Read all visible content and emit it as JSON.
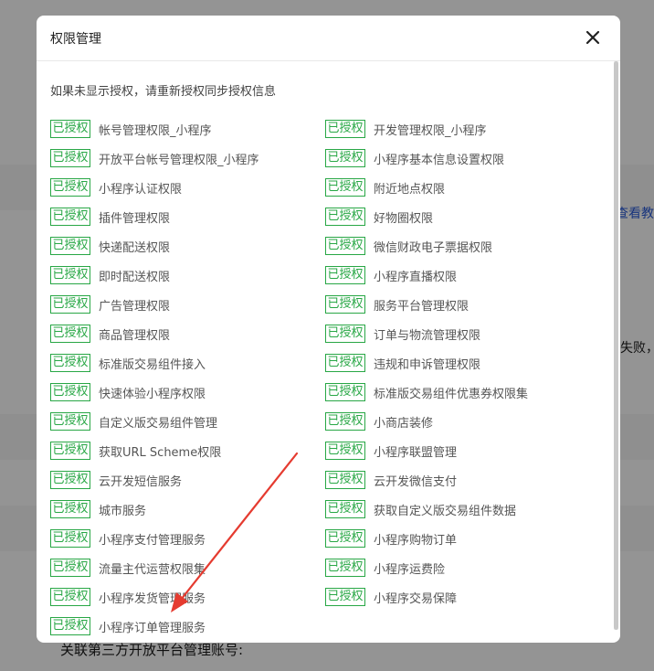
{
  "background": {
    "link_fragment": "查看教程",
    "text_fragment": "失败，请",
    "bottom_text": "关联第三方开放平台管理账号:"
  },
  "modal": {
    "title": "权限管理",
    "hint": "如果未显示授权，请重新授权同步授权信息",
    "badge_label": "已授权",
    "permissions": [
      {
        "name": "帐号管理权限_小程序",
        "status": "已授权"
      },
      {
        "name": "开发管理权限_小程序",
        "status": "已授权"
      },
      {
        "name": "开放平台帐号管理权限_小程序",
        "status": "已授权"
      },
      {
        "name": "小程序基本信息设置权限",
        "status": "已授权"
      },
      {
        "name": "小程序认证权限",
        "status": "已授权"
      },
      {
        "name": "附近地点权限",
        "status": "已授权"
      },
      {
        "name": "插件管理权限",
        "status": "已授权"
      },
      {
        "name": "好物圈权限",
        "status": "已授权"
      },
      {
        "name": "快递配送权限",
        "status": "已授权"
      },
      {
        "name": "微信财政电子票据权限",
        "status": "已授权"
      },
      {
        "name": "即时配送权限",
        "status": "已授权"
      },
      {
        "name": "小程序直播权限",
        "status": "已授权"
      },
      {
        "name": "广告管理权限",
        "status": "已授权"
      },
      {
        "name": "服务平台管理权限",
        "status": "已授权"
      },
      {
        "name": "商品管理权限",
        "status": "已授权"
      },
      {
        "name": "订单与物流管理权限",
        "status": "已授权"
      },
      {
        "name": "标准版交易组件接入",
        "status": "已授权"
      },
      {
        "name": "违规和申诉管理权限",
        "status": "已授权"
      },
      {
        "name": "快速体验小程序权限",
        "status": "已授权"
      },
      {
        "name": "标准版交易组件优惠券权限集",
        "status": "已授权"
      },
      {
        "name": "自定义版交易组件管理",
        "status": "已授权"
      },
      {
        "name": "小商店装修",
        "status": "已授权"
      },
      {
        "name": "获取URL Scheme权限",
        "status": "已授权"
      },
      {
        "name": "小程序联盟管理",
        "status": "已授权"
      },
      {
        "name": "云开发短信服务",
        "status": "已授权"
      },
      {
        "name": "云开发微信支付",
        "status": "已授权"
      },
      {
        "name": "城市服务",
        "status": "已授权"
      },
      {
        "name": "获取自定义版交易组件数据",
        "status": "已授权"
      },
      {
        "name": "小程序支付管理服务",
        "status": "已授权"
      },
      {
        "name": "小程序购物订单",
        "status": "已授权"
      },
      {
        "name": "流量主代运营权限集",
        "status": "已授权"
      },
      {
        "name": "小程序运费险",
        "status": "已授权"
      },
      {
        "name": "小程序发货管理服务",
        "status": "已授权"
      },
      {
        "name": "小程序交易保障",
        "status": "已授权"
      },
      {
        "name": "小程序订单管理服务",
        "status": "已授权"
      }
    ]
  },
  "annotation": {
    "color": "#e53b30"
  },
  "colors": {
    "badge_green": "#28a745",
    "overlay": "rgba(0,0,0,0.42)"
  }
}
